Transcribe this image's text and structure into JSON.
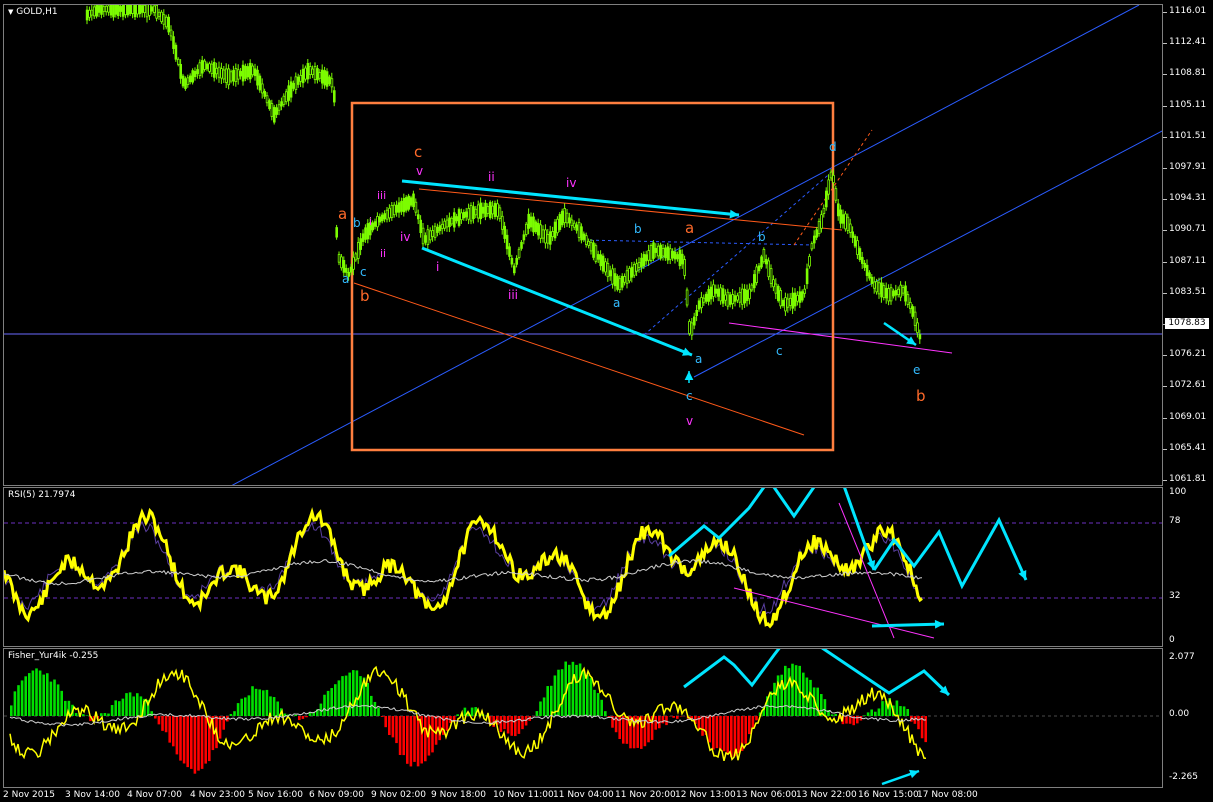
{
  "symbol": "GOLD,H1",
  "colors": {
    "bull_candle": "#7cfc00",
    "rsi_line": "#ffff00",
    "fisher_pos": "#00e000",
    "fisher_neg": "#ff0000",
    "annotation_arrow": "#00e5ff",
    "box": "#ff7f3f",
    "channel": "#2b5cff",
    "wave_orange": "#ff6a2a",
    "wave_magenta": "#ff33ff",
    "wave_cyan": "#33bbff"
  },
  "price_axis": [
    "1116.01",
    "1112.41",
    "1108.81",
    "1105.11",
    "1101.51",
    "1097.91",
    "1094.31",
    "1090.71",
    "1087.11",
    "1083.51",
    "1079.81",
    "1076.21",
    "1072.61",
    "1069.01",
    "1065.41",
    "1061.81"
  ],
  "current_price": "1078.83",
  "rsi": {
    "title": "RSI(5) 21.7974",
    "levels": [
      "100",
      "78",
      "32",
      "0"
    ]
  },
  "fisher": {
    "title": "Fisher_Yur4ik -0.255",
    "levels": [
      "2.077",
      "0.00",
      "-2.265"
    ]
  },
  "time_axis": [
    "2 Nov 2015",
    "3 Nov 14:00",
    "4 Nov 07:00",
    "4 Nov 23:00",
    "5 Nov 16:00",
    "6 Nov 09:00",
    "9 Nov 02:00",
    "9 Nov 18:00",
    "10 Nov 11:00",
    "11 Nov 04:00",
    "11 Nov 20:00",
    "12 Nov 13:00",
    "13 Nov 06:00",
    "13 Nov 22:00",
    "16 Nov 15:00",
    "17 Nov 08:00"
  ],
  "wave_labels": [
    {
      "t": "c",
      "c": "orange"
    },
    {
      "t": "v",
      "c": "magenta"
    },
    {
      "t": "iii",
      "c": "magenta"
    },
    {
      "t": "ii",
      "c": "magenta"
    },
    {
      "t": "iv",
      "c": "magenta"
    },
    {
      "t": "a",
      "c": "orange"
    },
    {
      "t": "b",
      "c": "cyan"
    },
    {
      "t": "i",
      "c": "magenta"
    },
    {
      "t": "ii",
      "c": "magenta"
    },
    {
      "t": "iv",
      "c": "magenta"
    },
    {
      "t": "a",
      "c": "cyan"
    },
    {
      "t": "c",
      "c": "cyan"
    },
    {
      "t": "b",
      "c": "orange"
    },
    {
      "t": "i",
      "c": "magenta"
    },
    {
      "t": "iii",
      "c": "magenta"
    },
    {
      "t": "a",
      "c": "cyan"
    },
    {
      "t": "b",
      "c": "cyan"
    },
    {
      "t": "a",
      "c": "orange"
    },
    {
      "t": "b",
      "c": "cyan"
    },
    {
      "t": "a",
      "c": "cyan"
    },
    {
      "t": "c",
      "c": "cyan"
    },
    {
      "t": "c",
      "c": "cyan"
    },
    {
      "t": "v",
      "c": "magenta"
    },
    {
      "t": "d",
      "c": "cyan"
    },
    {
      "t": "e",
      "c": "cyan"
    },
    {
      "t": "b",
      "c": "orange"
    }
  ]
}
